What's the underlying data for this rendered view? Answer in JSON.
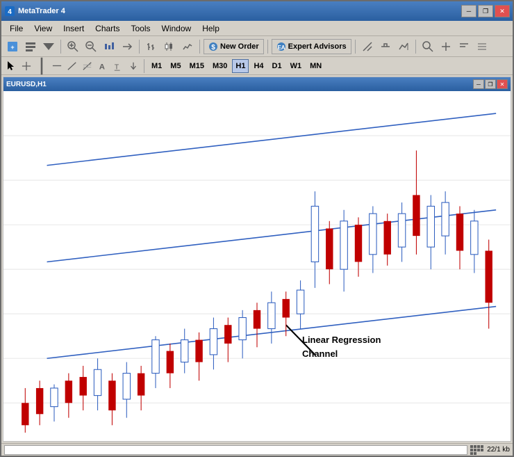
{
  "window": {
    "title": "MetaTrader 4",
    "title_bar_buttons": {
      "minimize": "─",
      "restore": "❐",
      "close": "✕"
    }
  },
  "menu": {
    "items": [
      "File",
      "View",
      "Insert",
      "Charts",
      "Tools",
      "Window",
      "Help"
    ]
  },
  "toolbar1": {
    "new_order_label": "New Order",
    "expert_advisors_label": "Expert Advisors"
  },
  "toolbar2": {
    "periods": [
      "M1",
      "M5",
      "M15",
      "M30",
      "H1",
      "H4",
      "D1",
      "W1",
      "MN"
    ],
    "active_period": "H1"
  },
  "chart": {
    "annotation": {
      "line1": "Linear Regression",
      "line2": "Channel"
    }
  },
  "status_bar": {
    "info": "22/1 kb"
  },
  "inner_window": {
    "title": "EURUSD,H1",
    "buttons": {
      "minimize": "─",
      "restore": "❐",
      "close": "✕"
    }
  }
}
